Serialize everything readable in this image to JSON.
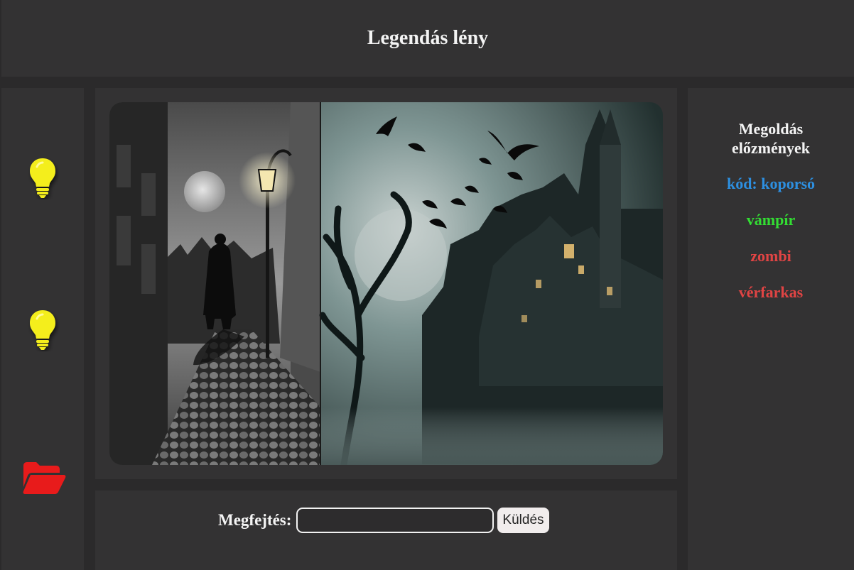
{
  "header": {
    "title": "Legendás lény"
  },
  "sidebar": {
    "icons": [
      "lightbulb-icon",
      "lightbulb-icon",
      "folder-open-icon"
    ],
    "colors": {
      "hint": "#f4ee1c",
      "folder": "#e81b1b"
    }
  },
  "puzzle": {
    "image_description_icon": "vampire-castle-scene"
  },
  "form": {
    "label": "Megfejtés:",
    "input_value": "",
    "input_placeholder": "",
    "submit_label": "Küldés"
  },
  "history": {
    "title_line1": "Megoldás",
    "title_line2": "előzmények",
    "items": [
      {
        "text": "kód: koporsó",
        "color": "#2d8fe0"
      },
      {
        "text": "vámpír",
        "color": "#33dd33"
      },
      {
        "text": "zombi",
        "color": "#e04444"
      },
      {
        "text": "vérfarkas",
        "color": "#e04444"
      }
    ]
  }
}
